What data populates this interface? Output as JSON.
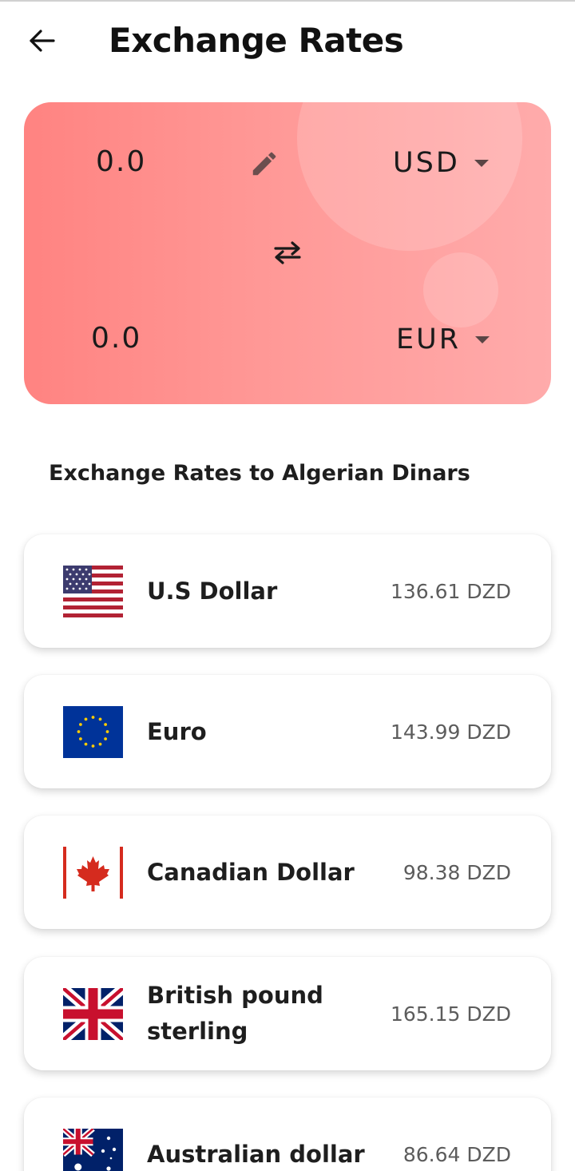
{
  "header": {
    "title": "Exchange Rates",
    "back_icon": "arrow-back-icon"
  },
  "converter": {
    "from_amount": "0.0",
    "from_currency": "USD",
    "to_amount": "0.0",
    "to_currency": "EUR",
    "edit_icon": "pencil-icon",
    "swap_icon": "swap-arrows-icon",
    "gradient_start": "#ff8381",
    "gradient_end": "#ffabab"
  },
  "section": {
    "title": "Exchange Rates to Algerian Dinars"
  },
  "rates": [
    {
      "name": "U.S Dollar",
      "value": "136.61 DZD",
      "flag": "us-flag-icon"
    },
    {
      "name": "Euro",
      "value": "143.99 DZD",
      "flag": "eu-flag-icon"
    },
    {
      "name": "Canadian Dollar",
      "value": "98.38 DZD",
      "flag": "canada-flag-icon"
    },
    {
      "name": "British pound sterling",
      "value": "165.15 DZD",
      "flag": "uk-flag-icon"
    },
    {
      "name": "Australian dollar",
      "value": "86.64 DZD",
      "flag": "australia-flag-icon"
    }
  ]
}
